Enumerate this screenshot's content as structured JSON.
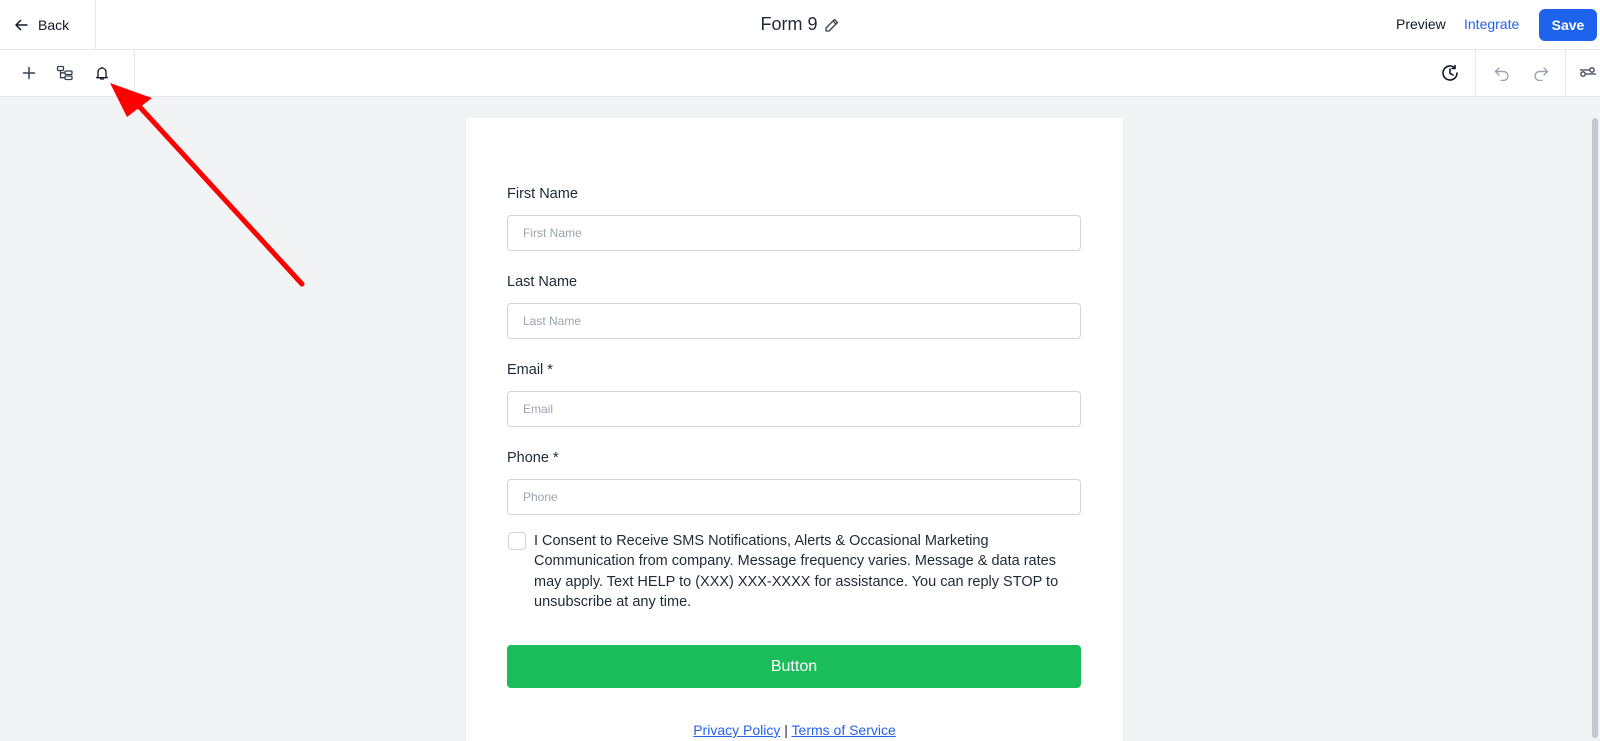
{
  "header": {
    "back_label": "Back",
    "form_title": "Form 9",
    "preview_label": "Preview",
    "integrate_label": "Integrate",
    "save_label": "Save"
  },
  "toolbar": {
    "left_icons": [
      "plus-icon",
      "field-tree-icon",
      "bell-icon"
    ],
    "right_icons": [
      "history-icon",
      "undo-icon",
      "redo-icon",
      "settings-sliders-icon"
    ]
  },
  "form": {
    "fields": [
      {
        "label": "First Name",
        "placeholder": "First Name",
        "value": ""
      },
      {
        "label": "Last Name",
        "placeholder": "Last Name",
        "value": ""
      },
      {
        "label": "Email *",
        "placeholder": "Email",
        "value": ""
      },
      {
        "label": "Phone *",
        "placeholder": "Phone",
        "value": ""
      }
    ],
    "consent_text": "I Consent to Receive SMS Notifications, Alerts & Occasional Marketing Communication from company. Message frequency varies. Message & data rates may apply. Text HELP to (XXX) XXX-XXXX for assistance. You can reply STOP to unsubscribe at any time.",
    "consent_checked": false,
    "submit_label": "Button",
    "privacy_label": "Privacy Policy",
    "footer_separator": " | ",
    "terms_label": "Terms of Service"
  },
  "colors": {
    "save_button": "#1d63ed",
    "integrate_link": "#2563eb",
    "submit_button": "#1bbd5b",
    "canvas_background": "#f2f3f5",
    "annotation_arrow": "#ff0000"
  }
}
